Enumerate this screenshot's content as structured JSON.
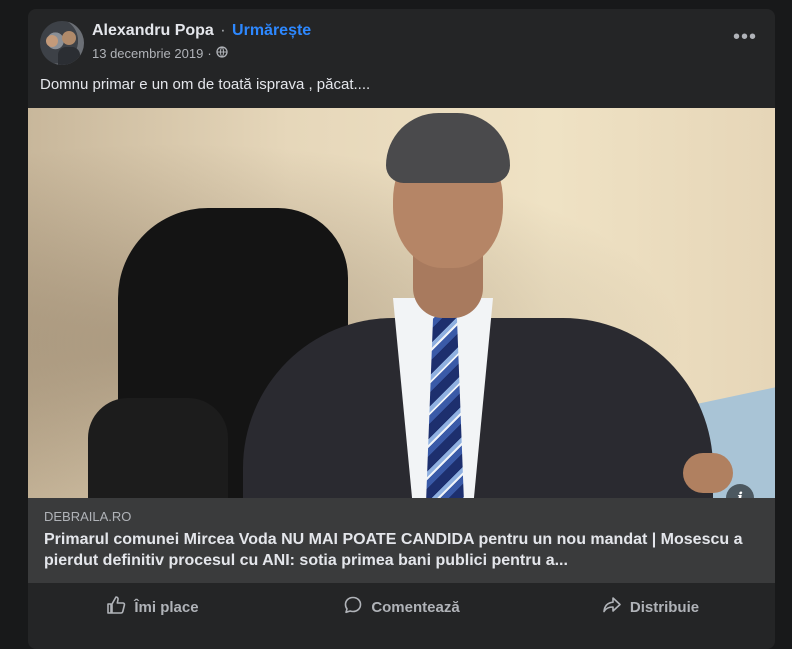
{
  "post": {
    "author": "Alexandru Popa",
    "separator": "·",
    "follow_label": "Urmărește",
    "date": "13 decembrie 2019",
    "date_separator": "·",
    "privacy_icon": "globe-icon",
    "more_label": "•••",
    "text": "Domnu primar e un om de toată isprava  , păcat...."
  },
  "link": {
    "domain": "DEBRAILA.RO",
    "title": "Primarul comunei Mircea Voda NU MAI POATE CANDIDA pentru un nou mandat | Mosescu a pierdut definitiv procesul cu ANI: sotia primea bani publici pentru a...",
    "info_label": "i"
  },
  "actions": {
    "like": "Îmi place",
    "comment": "Comentează",
    "share": "Distribuie"
  }
}
